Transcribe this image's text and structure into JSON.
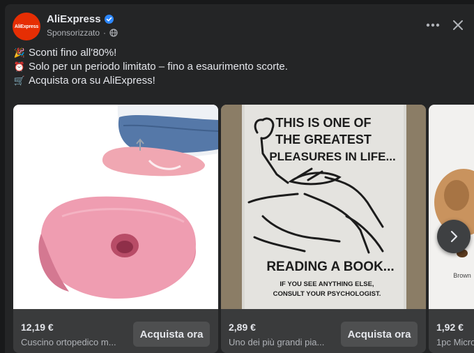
{
  "header": {
    "avatar_text": "AliExpress",
    "page_name": "AliExpress",
    "sponsored_label": "Sponsorizzato",
    "verified_icon": "verified-badge-icon",
    "privacy_icon": "globe-icon"
  },
  "post": {
    "lines": [
      {
        "emoji": "🎉",
        "text": "Sconti fino all'80%!"
      },
      {
        "emoji": "⏰",
        "text": "Solo per un periodo limitato – fino a esaurimento scorte."
      },
      {
        "emoji": "🛒",
        "text": "Acquista ora su AliExpress!"
      }
    ]
  },
  "carousel": {
    "cards": [
      {
        "price": "12,19 €",
        "title": "Cuscino ortopedico m...",
        "cta": "Acquista ora"
      },
      {
        "price": "2,89 €",
        "title": "Uno dei più grandi pia...",
        "cta": "Acquista ora",
        "sign": {
          "line1": "THIS IS ONE OF",
          "line2": "THE GREATEST",
          "line3": "PLEASURES IN LIFE...",
          "line4": "READING A BOOK...",
          "line5": "IF YOU SEE ANYTHING ELSE,",
          "line6": "CONSULT YOUR PSYCHOLOGIST."
        }
      },
      {
        "price": "1,92 €",
        "title": "1pc Micro",
        "image_label": "Brown"
      }
    ]
  },
  "colors": {
    "background": "#18191a",
    "card": "#242526",
    "footer": "#3a3b3c",
    "button": "#4e4f50",
    "brand": "#e62e04",
    "verified": "#2d88ff"
  }
}
